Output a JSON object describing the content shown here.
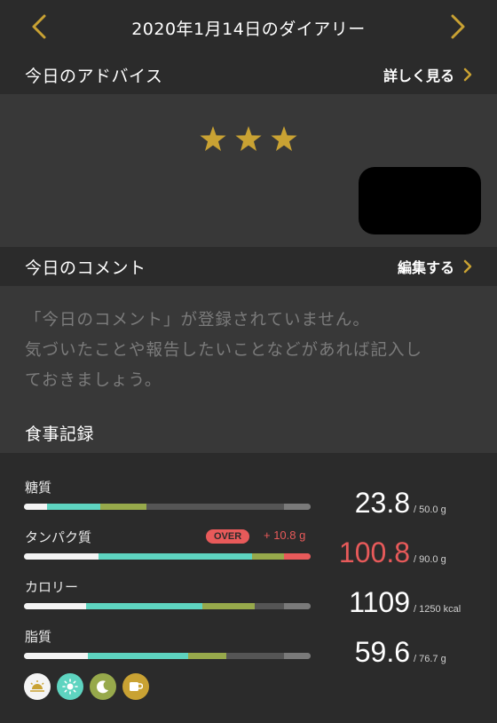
{
  "header": {
    "title": "2020年1月14日のダイアリー",
    "prev_icon": "chevron-left-icon",
    "next_icon": "chevron-right-icon"
  },
  "advice": {
    "title": "今日のアドバイス",
    "action_label": "詳しく見る",
    "rating_stars": 3,
    "star_color": "#c9a233"
  },
  "comment": {
    "title": "今日のコメント",
    "action_label": "編集する",
    "placeholder_lines": [
      "「今日のコメント」が登録されていません。",
      "気づいたことや報告したいことなどがあれば記入し",
      "ておきましょう。"
    ]
  },
  "meals": {
    "title": "食事記録",
    "nutrients": [
      {
        "label": "糖質",
        "value": "23.8",
        "target": "/ 50.0 g",
        "over": false
      },
      {
        "label": "タンパク質",
        "value": "100.8",
        "target": "/ 90.0 g",
        "over": true,
        "over_badge": "OVER",
        "over_amount": "+ 10.8 g"
      },
      {
        "label": "カロリー",
        "value": "1109",
        "target": "/ 1250 kcal",
        "over": false
      },
      {
        "label": "脂質",
        "value": "59.6",
        "target": "/ 76.7 g",
        "over": false
      }
    ],
    "meal_types": [
      {
        "icon": "sunrise-icon",
        "color": "#f4f4f4"
      },
      {
        "icon": "sun-icon",
        "color": "#5ed4c0"
      },
      {
        "icon": "moon-icon",
        "color": "#97a94b"
      },
      {
        "icon": "cup-icon",
        "color": "#c9a233"
      }
    ],
    "colors": {
      "breakfast": "#f4f4f4",
      "lunch": "#5ed4c0",
      "dinner": "#97a94b",
      "snack": "#c9a233",
      "over": "#e85a5a",
      "accent": "#c9a233"
    }
  }
}
